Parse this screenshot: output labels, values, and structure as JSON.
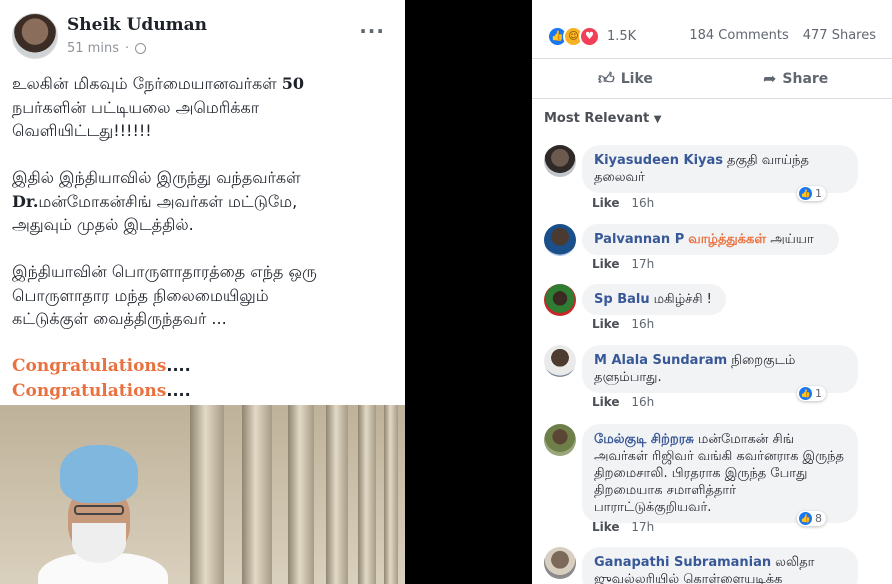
{
  "post": {
    "author": "Sheik Uduman",
    "time": "51 mins",
    "separator": "·",
    "lines": {
      "l1a": "உலகின் மிகவும் நேர்மையானவர்கள் ",
      "l1b": "50",
      "l2": "நபர்களின் பட்டியலை அமெரிக்கா",
      "l3": "வெளியிட்டது!!!!!!",
      "l4": "இதில் இந்தியாவில் இருந்து வந்தவர்கள்",
      "l5a": "Dr.",
      "l5b": "மன்மோகன்சிங் அவர்கள் மட்டுமே,",
      "l6": "அதுவும் முதல் இடத்தில்.",
      "l7": "இந்தியாவின் பொருளாதாரத்தை எந்த ஒரு",
      "l8": "பொருளாதார மந்த நிலைமையிலும்",
      "l9": "கட்டுக்குள் வைத்திருந்தவர் ...",
      "congrats": "Congratulations",
      "ellipsis": "...."
    }
  },
  "stats": {
    "reaction_count": "1.5K",
    "comments": "184 Comments",
    "shares": "477 Shares"
  },
  "actions": {
    "like": "Like",
    "share": "Share"
  },
  "sort_label": "Most Relevant",
  "icons": {
    "like": "thumb-up-icon",
    "share": "share-arrow-icon",
    "more": "more-options-icon",
    "globe": "globe-icon"
  },
  "comments": [
    {
      "name": "Kiyasudeen Kiyas",
      "text": "தகுதி வாய்ந்த தலைவர்",
      "like": "Like",
      "time": "16h",
      "reactions": "1"
    },
    {
      "name": "Palvannan P",
      "highlight": "வாழ்த்துக்கள்",
      "text": "அய்யா",
      "like": "Like",
      "time": "17h"
    },
    {
      "name": "Sp Balu",
      "text": "மகிழ்ச்சி !",
      "like": "Like",
      "time": "16h"
    },
    {
      "name": "M Alala Sundaram",
      "text": "நிறைகுடம் தளும்பாது.",
      "like": "Like",
      "time": "16h",
      "reactions": "1"
    },
    {
      "name": "மேல்குடி சிற்றரசு",
      "text": "மன்மோகன் சிங் அவர்கள் ரிஜிவர் வங்கி கவர்னராக இருந்த திறமைசாலி. பிரதராக இருந்த போது திறமையாக சமாளித்தார் பாராட்டுக்குறியவர்.",
      "like": "Like",
      "time": "17h",
      "reactions": "8"
    },
    {
      "name": "Ganapathi Subramanian",
      "text": "லலிதா ஜுவல்லரியில் கொள்ளையடிக்க"
    }
  ]
}
